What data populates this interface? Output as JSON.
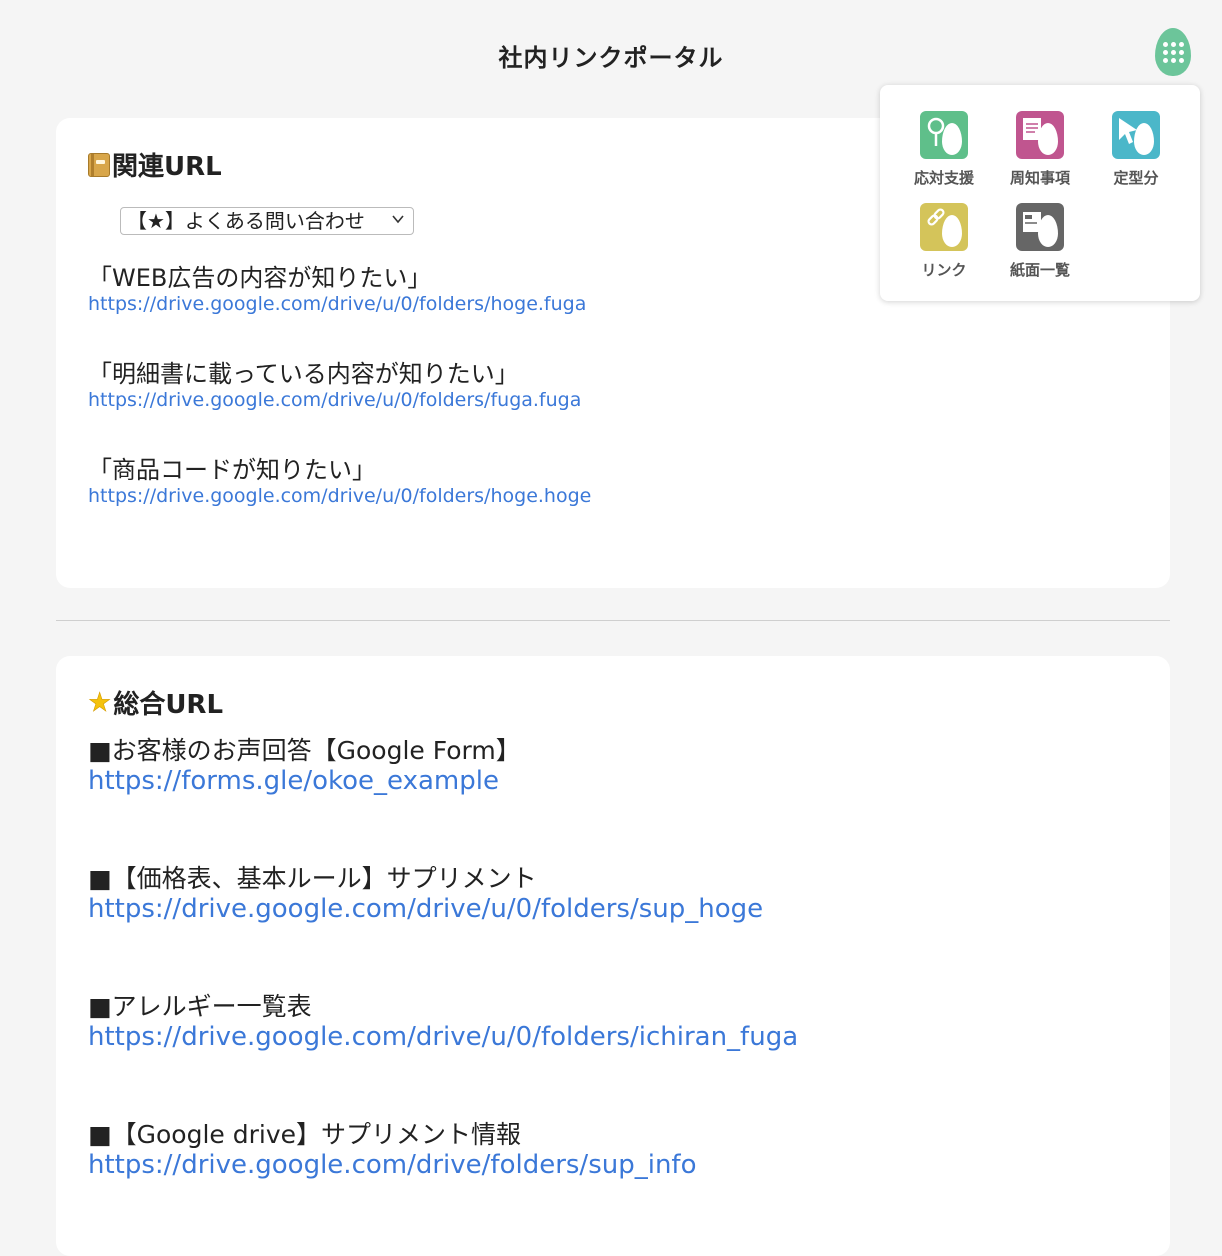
{
  "header": {
    "title": "社内リンクポータル"
  },
  "related": {
    "heading": "関連URL",
    "select_value": "【★】よくある問い合わせ",
    "items": [
      {
        "q": "「WEB広告の内容が知りたい」",
        "url": "https://drive.google.com/drive/u/0/folders/hoge.fuga"
      },
      {
        "q": "「明細書に載っている内容が知りたい」",
        "url": "https://drive.google.com/drive/u/0/folders/fuga.fuga"
      },
      {
        "q": "「商品コードが知りたい」",
        "url": "https://drive.google.com/drive/u/0/folders/hoge.hoge"
      }
    ]
  },
  "general": {
    "heading": "総合URL",
    "items": [
      {
        "title": "■お客様のお声回答【Google Form】",
        "url": "https://forms.gle/okoe_example"
      },
      {
        "title": "■【価格表、基本ルール】サプリメント",
        "url": "https://drive.google.com/drive/u/0/folders/sup_hoge"
      },
      {
        "title": "■アレルギー一覧表",
        "url": "https://drive.google.com/drive/u/0/folders/ichiran_fuga"
      },
      {
        "title": "■【Google drive】サプリメント情報",
        "url": "https://drive.google.com/drive/folders/sup_info"
      }
    ]
  },
  "apps_menu": {
    "items": [
      {
        "label": "応対支援",
        "color": "#5fbf8a",
        "icon": "magnifier-icon"
      },
      {
        "label": "周知事項",
        "color": "#c0558f",
        "icon": "notice-icon"
      },
      {
        "label": "定型分",
        "color": "#4bb7c9",
        "icon": "cursor-icon"
      },
      {
        "label": "リンク",
        "color": "#d4c45a",
        "icon": "link-icon"
      },
      {
        "label": "紙面一覧",
        "color": "#666666",
        "icon": "paper-icon"
      }
    ]
  }
}
